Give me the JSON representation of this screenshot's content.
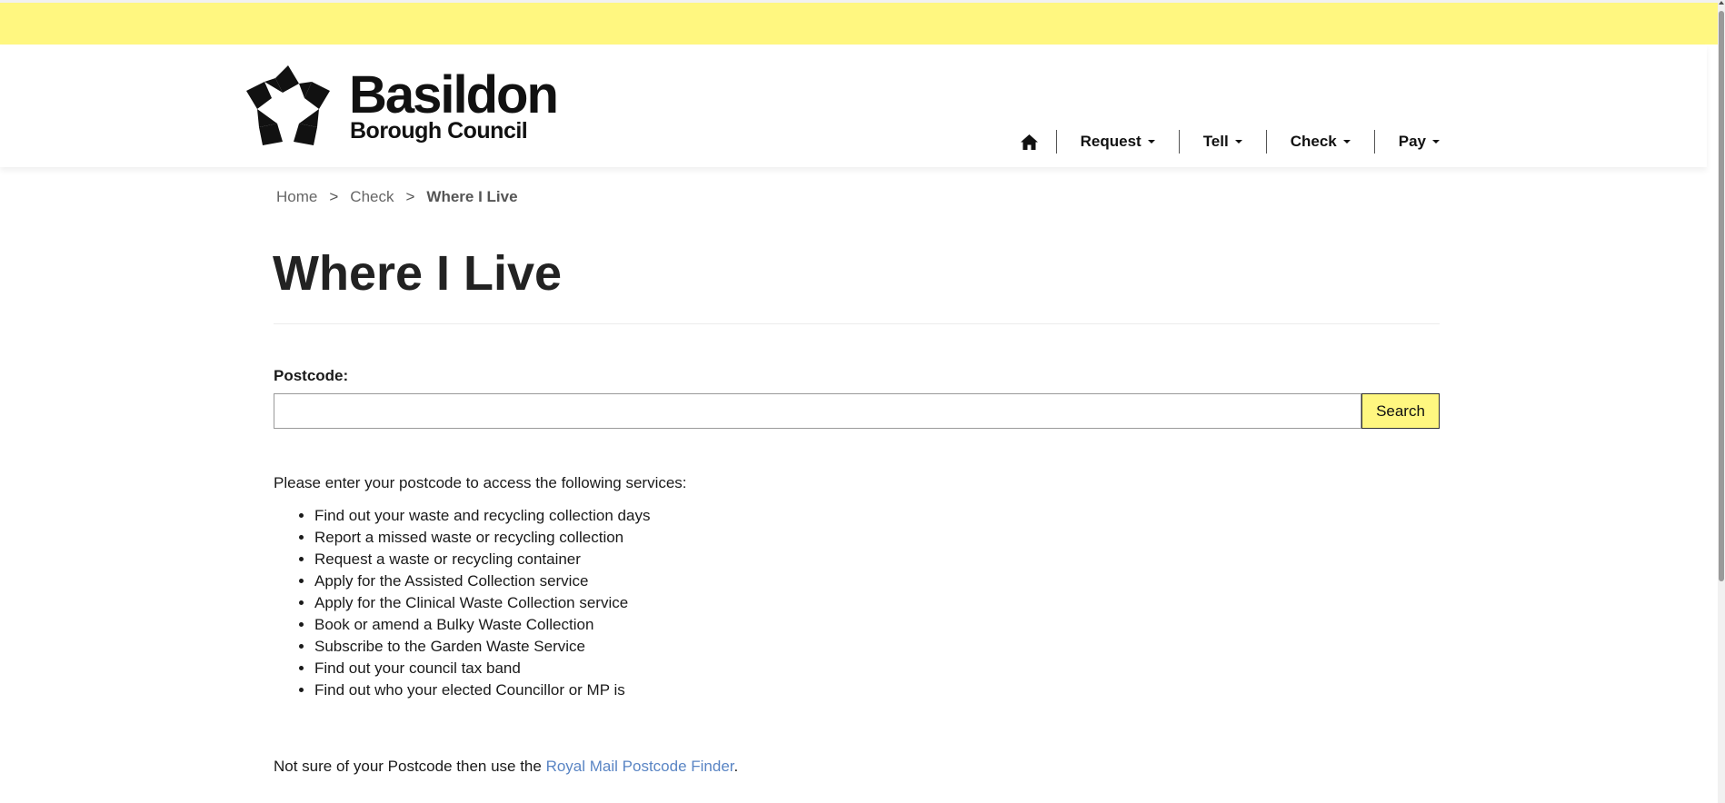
{
  "brand": {
    "name": "Basildon",
    "subtitle": "Borough Council",
    "accent_color": "#fff780"
  },
  "nav": {
    "home_icon": "home-icon",
    "items": [
      {
        "label": "Request"
      },
      {
        "label": "Tell"
      },
      {
        "label": "Check"
      },
      {
        "label": "Pay"
      }
    ]
  },
  "breadcrumb": {
    "home": "Home",
    "separator": ">",
    "check": "Check",
    "current": "Where I Live"
  },
  "page": {
    "title": "Where I Live"
  },
  "form": {
    "postcode_label": "Postcode:",
    "postcode_value": "",
    "search_label": "Search"
  },
  "content": {
    "intro": "Please enter your postcode to access the following services:",
    "services": [
      "Find out your waste and recycling collection days",
      "Report a missed waste or recycling collection",
      "Request a waste or recycling container",
      "Apply for the Assisted Collection service",
      "Apply for the Clinical Waste Collection service",
      "Book or amend a Bulky Waste Collection",
      "Subscribe to the Garden Waste Service",
      "Find out your council tax band",
      "Find out who your elected Councillor or MP is"
    ],
    "finder_prefix": "Not sure of your Postcode then use the ",
    "finder_link": "Royal Mail Postcode Finder",
    "finder_suffix": ".",
    "link_color": "#5a85c4"
  }
}
